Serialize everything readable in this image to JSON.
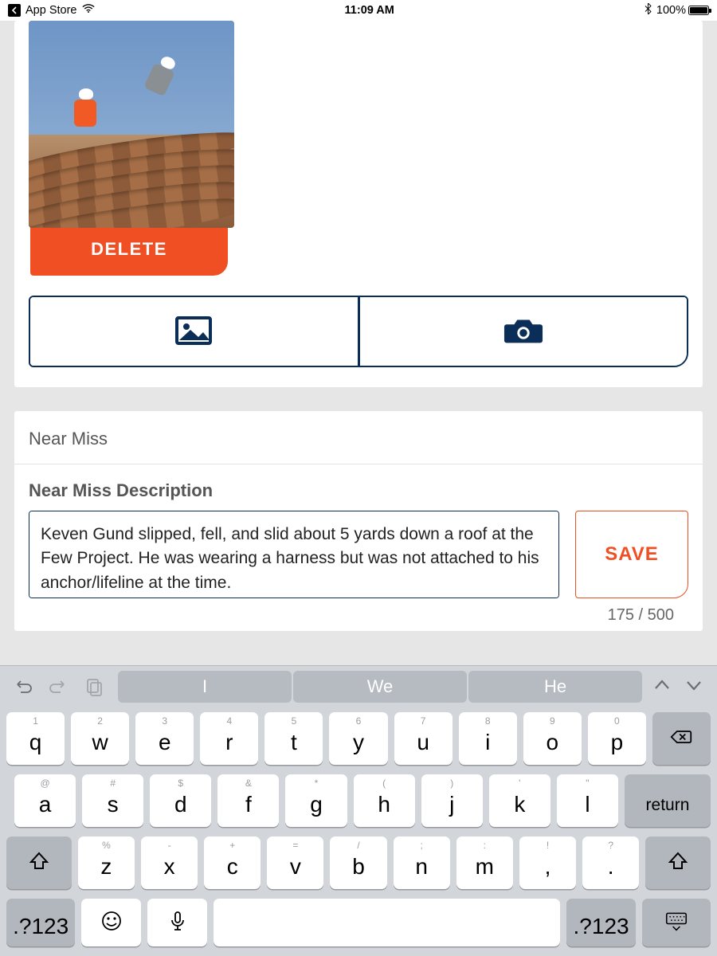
{
  "status": {
    "back_label": "App Store",
    "time": "11:09 AM",
    "battery_pct": "100%"
  },
  "photo": {
    "delete_label": "DELETE"
  },
  "section": {
    "title": "Near Miss",
    "desc_label": "Near Miss Description",
    "desc_value": "Keven Gund slipped, fell, and slid about 5 yards down a roof at the Few Project. He was wearing a harness but was not attached to his anchor/lifeline at the time.",
    "save_label": "SAVE",
    "counter": "175 / 500"
  },
  "keyboard": {
    "suggestions": [
      "I",
      "We",
      "He"
    ],
    "row1": [
      {
        "h": "1",
        "m": "q"
      },
      {
        "h": "2",
        "m": "w"
      },
      {
        "h": "3",
        "m": "e"
      },
      {
        "h": "4",
        "m": "r"
      },
      {
        "h": "5",
        "m": "t"
      },
      {
        "h": "6",
        "m": "y"
      },
      {
        "h": "7",
        "m": "u"
      },
      {
        "h": "8",
        "m": "i"
      },
      {
        "h": "9",
        "m": "o"
      },
      {
        "h": "0",
        "m": "p"
      }
    ],
    "row2": [
      {
        "h": "@",
        "m": "a"
      },
      {
        "h": "#",
        "m": "s"
      },
      {
        "h": "$",
        "m": "d"
      },
      {
        "h": "&",
        "m": "f"
      },
      {
        "h": "*",
        "m": "g"
      },
      {
        "h": "(",
        "m": "h"
      },
      {
        "h": ")",
        "m": "j"
      },
      {
        "h": "'",
        "m": "k"
      },
      {
        "h": "\"",
        "m": "l"
      }
    ],
    "return_label": "return",
    "row3": [
      {
        "h": "%",
        "m": "z"
      },
      {
        "h": "-",
        "m": "x"
      },
      {
        "h": "+",
        "m": "c"
      },
      {
        "h": "=",
        "m": "v"
      },
      {
        "h": "/",
        "m": "b"
      },
      {
        "h": ";",
        "m": "n"
      },
      {
        "h": ":",
        "m": "m"
      },
      {
        "h": "!",
        "m": ","
      },
      {
        "h": "?",
        "m": "."
      }
    ],
    "sym_label": ".?123"
  }
}
